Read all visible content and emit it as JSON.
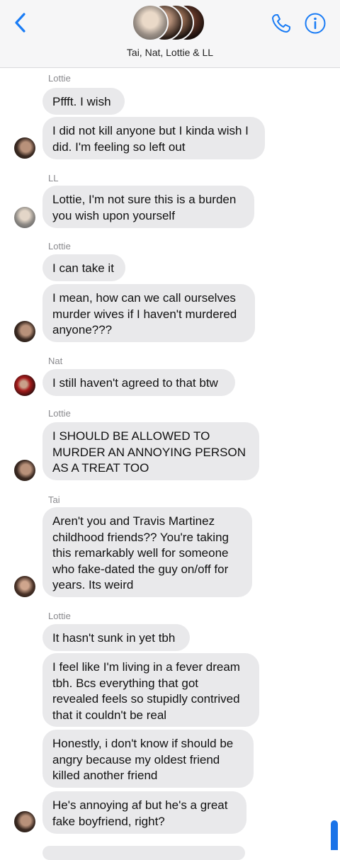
{
  "header": {
    "group_name": "Tai, Nat, Lottie & LL",
    "accent_color": "#1a7cf5",
    "back_icon": "chevron-left-icon",
    "call_icon": "phone-icon",
    "details_icon": "info-icon"
  },
  "thread": {
    "senders": {
      "lottie_1": "Lottie",
      "ll": "LL",
      "lottie_2": "Lottie",
      "nat": "Nat",
      "lottie_3": "Lottie",
      "tai": "Tai",
      "lottie_4": "Lottie"
    },
    "messages": [
      "Pffft. I wish",
      "I did not kill anyone but I kinda wish I\ndid. I'm feeling so left out",
      "Lottie, I'm not sure this is a burden\nyou wish upon yourself",
      "I can take it",
      "I mean, how can we call ourselves\nmurder wives if I haven't murdered\nanyone???",
      "I still haven't agreed to that btw",
      "I SHOULD BE ALLOWED TO\nMURDER AN ANNOYING PERSON\nAS A TREAT TOO",
      "Aren't you and Travis Martinez\nchildhood friends?? You're taking\nthis remarkably well for someone\nwho fake-dated the guy on/off for\nyears. Its weird",
      "It hasn't sunk in yet tbh",
      "I feel like I'm living in a fever dream\ntbh. Bcs everything that got\nrevealed feels so stupidly contrived\nthat it couldn't be real",
      "Honestly, i don't know if should be\nangry because my oldest friend\nkilled another friend",
      "He's annoying af but he's a great\nfake boyfriend, right?"
    ]
  }
}
